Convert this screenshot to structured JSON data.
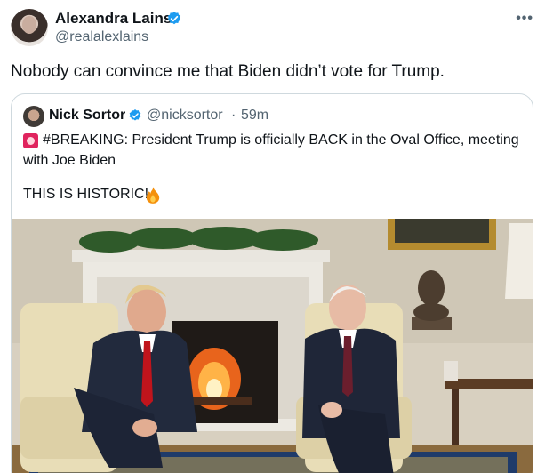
{
  "tweet": {
    "author_name": "Alexandra Lains",
    "author_handle": "@realalexlains",
    "text": "Nobody can convince me that Biden didn’t vote for Trump.",
    "more_icon": "more-horizontal-icon"
  },
  "quote": {
    "author_name": "Nick Sortor",
    "author_handle": "@nicksortor",
    "separator": "·",
    "time": "59m",
    "line1": "#BREAKING: President Trump is officially BACK in the Oval Office, meeting",
    "line2": "with Joe Biden",
    "line3": "THIS IS HISTORIC!",
    "media": "Oval Office photo: Trump and Biden seated in armchairs in front of a lit fireplace"
  },
  "colors": {
    "verified": "#1d9bf0",
    "secondary_text": "#536471",
    "border": "#cfd9de"
  }
}
